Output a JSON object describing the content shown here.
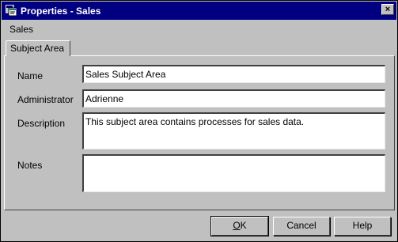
{
  "window": {
    "title": "Properties - Sales",
    "close_glyph": "×",
    "icon": "properties-window-icon"
  },
  "object_name": "Sales",
  "tabs": [
    {
      "label": "Subject Area"
    }
  ],
  "fields": {
    "name": {
      "label": "Name",
      "value": "Sales Subject Area"
    },
    "administrator": {
      "label": "Administrator",
      "value": "Adrienne"
    },
    "description": {
      "label": "Description",
      "value": "This subject area contains processes for sales data."
    },
    "notes": {
      "label": "Notes",
      "value": ""
    }
  },
  "buttons": {
    "ok_mnemonic": "O",
    "ok_rest": "K",
    "cancel": "Cancel",
    "help": "Help"
  }
}
